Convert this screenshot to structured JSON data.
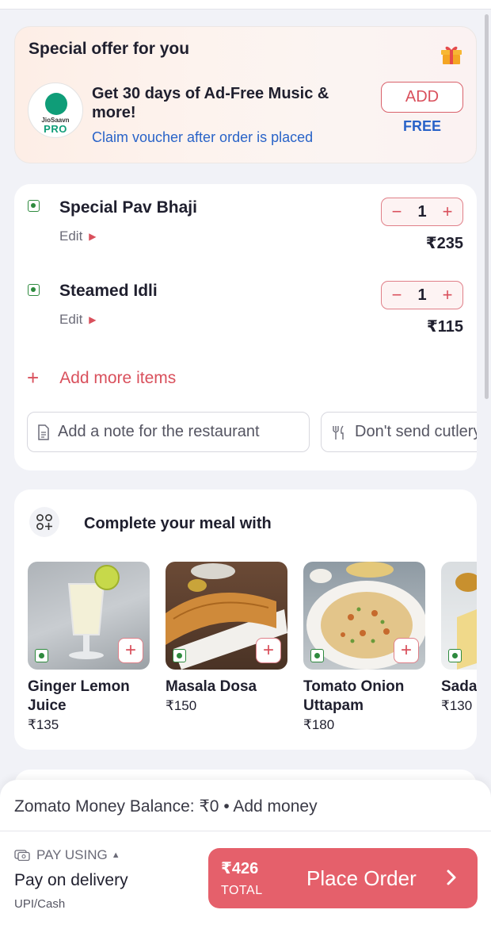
{
  "offer": {
    "title": "Special offer for you",
    "logo_brand": "JioSaavn",
    "logo_badge": "PRO",
    "headline": "Get 30 days of Ad-Free Music & more!",
    "link": "Claim voucher after order is placed",
    "add_label": "ADD",
    "free_label": "FREE"
  },
  "cart": {
    "items": [
      {
        "name": "Special Pav Bhaji",
        "edit": "Edit",
        "qty": "1",
        "price": "₹235"
      },
      {
        "name": "Steamed Idli",
        "edit": "Edit",
        "qty": "1",
        "price": "₹115"
      }
    ],
    "add_more": "Add more items",
    "note_chip": "Add a note for the restaurant",
    "cutlery_chip": "Don't send cutlery"
  },
  "meal": {
    "title": "Complete your meal with",
    "products": [
      {
        "name_line1": "Ginger Lemon",
        "name_line2": "Juice",
        "price": "₹135"
      },
      {
        "name_line1": "Masala Dosa",
        "name_line2": "",
        "price": "₹150"
      },
      {
        "name_line1": "Tomato Onion",
        "name_line2": "Uttapam",
        "price": "₹180"
      },
      {
        "name_line1": "Sada Dosa",
        "name_line2": "",
        "price": "₹130"
      }
    ]
  },
  "checkout": {
    "balance": "Zomato Money Balance: ₹0 • Add money",
    "pay_using": "PAY USING",
    "pay_method": "Pay on delivery",
    "pay_sub": "UPI/Cash",
    "amount": "₹426",
    "total_label": "TOTAL",
    "place_order": "Place Order"
  },
  "colors": {
    "accent": "#e5606b",
    "link_blue": "#2963c8",
    "veg_green": "#2e8a3e",
    "background": "#f1f2f7"
  }
}
